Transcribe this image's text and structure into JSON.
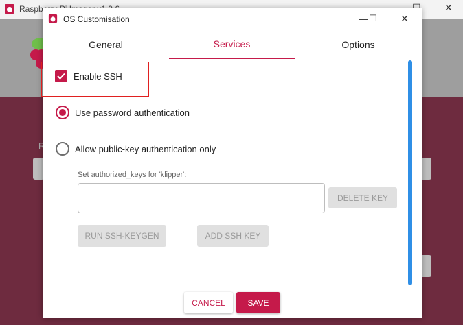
{
  "background_window": {
    "title": "Raspberry Pi Imager v1.9.6",
    "letter": "R",
    "controls": {
      "minimize": "—",
      "maximize": "☐",
      "close": "✕"
    }
  },
  "dialog": {
    "title": "OS Customisation",
    "controls": {
      "minimize": "—",
      "maximize": "☐",
      "close": "✕"
    },
    "tabs": [
      {
        "label": "General",
        "active": false
      },
      {
        "label": "Services",
        "active": true
      },
      {
        "label": "Options",
        "active": false
      }
    ],
    "enable_ssh": {
      "label": "Enable SSH",
      "checked": true
    },
    "auth_password": {
      "label": "Use password authentication",
      "selected": true
    },
    "auth_pubkey": {
      "label": "Allow public-key authentication only",
      "selected": false
    },
    "authorized_keys": {
      "label": "Set authorized_keys for 'klipper':",
      "value": ""
    },
    "delete_key_label": "DELETE KEY",
    "run_keygen_label": "RUN SSH-KEYGEN",
    "add_key_label": "ADD SSH KEY",
    "cancel_label": "CANCEL",
    "save_label": "SAVE"
  },
  "colors": {
    "accent": "#c51a4a",
    "scrollbar": "#2f8fe6",
    "highlight_box": "#e02020",
    "background_body": "#6e2b3f"
  }
}
